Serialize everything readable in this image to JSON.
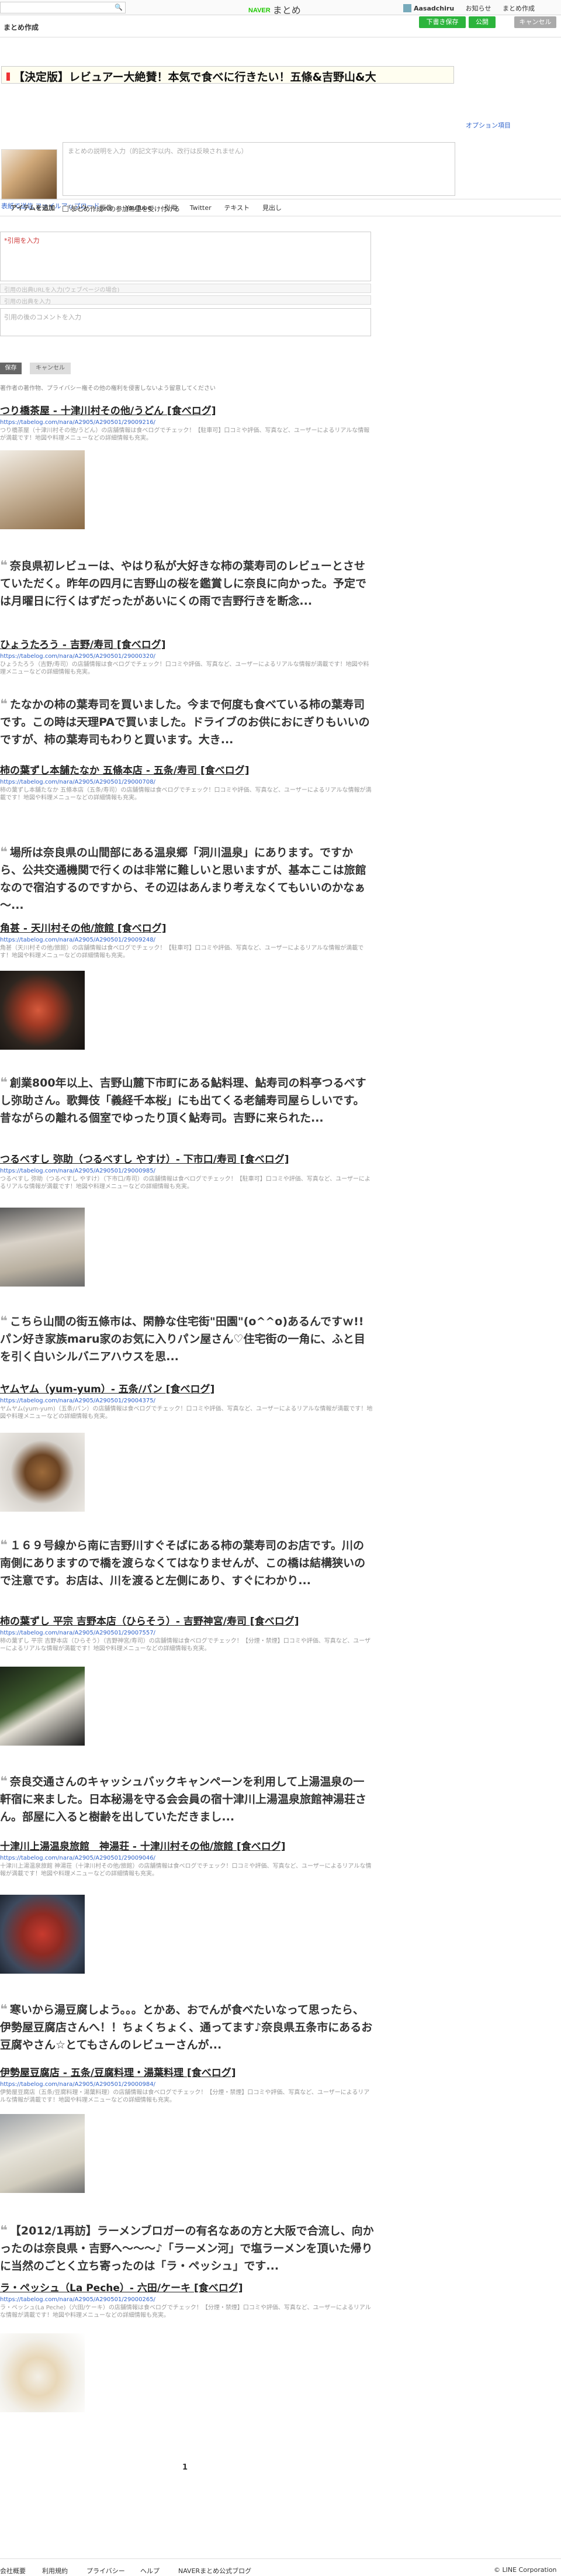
{
  "topbar": {
    "logo_naver": "NAVER",
    "logo_text": "まとめ",
    "user": "Aasadchiru",
    "nav": [
      "お知らせ",
      "まとめ作成"
    ]
  },
  "header": {
    "title": "まとめ作成",
    "btn_draft": "下書き保存",
    "btn_publish": "公開",
    "btn_cancel": "キャンセル"
  },
  "editor": {
    "title": "【決定版】レビュアー大絶賛！本気で食べに行きたい！五條&吉野山&大",
    "option_link": "オプション項目",
    "description_placeholder": "まとめの説明を入力（的記文字以内、改行は反映されません）",
    "thumbnail_link": "表紙で送信 ファイルアップロード",
    "accept_label": "まとめ作成への参加希望を受け付ける"
  },
  "tabs": [
    "アイテムを追加",
    "リンク",
    "画像",
    "YouTube",
    "引用",
    "Twitter",
    "テキスト",
    "見出し"
  ],
  "form": {
    "quote_placeholder": "*引用を入力",
    "source_url": "引用の出典URLを入力(ウェブページの場合)",
    "source_title": "引用の出典を入力",
    "comment_placeholder": "引用の後のコメントを入力",
    "save": "保存",
    "cancel": "キャンセル",
    "note": "著作者の著作物、プライバシー権その他の権利を侵害しないよう留意してください"
  },
  "items": [
    {
      "title": "つり橋茶屋 - 十津川村その他/うどん [食べログ]",
      "url": "https://tabelog.com/nara/A2905/A290501/29009216/",
      "desc": "つり橋茶屋（十津川村その他/うどん）の店舗情報は食べログでチェック！【駐車可】口コミや評価、写真など、ユーザーによるリアルな情報が満載です！地図や料理メニューなどの詳細情報も充実。"
    },
    {
      "quote": "奈良県初レビューは、やはり私が大好きな柿の葉寿司のレビューとさせていただく。昨年の四月に吉野山の桜を鑑賞しに奈良に向かった。予定では月曜日に行くはずだったがあいにくの雨で吉野行きを断念...",
      "title": "ひょうたろう - 吉野/寿司 [食べログ]",
      "url": "https://tabelog.com/nara/A2905/A290501/29000320/",
      "desc": "ひょうたろう（吉野/寿司）の店舗情報は食べログでチェック！口コミや評価、写真など、ユーザーによるリアルな情報が満載です！地図や料理メニューなどの詳細情報も充実。"
    },
    {
      "quote": "たなかの柿の葉寿司を買いました。今まで何度も食べている柿の葉寿司です。この時は天理PAで買いました。ドライブのお供におにぎりもいいのですが、柿の葉寿司もわりと買います。大き...",
      "title": "柿の葉ずし本舗たなか 五條本店 - 五条/寿司 [食べログ]",
      "url": "https://tabelog.com/nara/A2905/A290501/29000708/",
      "desc": "柿の葉ずし本舗たなか 五條本店（五条/寿司）の店舗情報は食べログでチェック！口コミや評価、写真など、ユーザーによるリアルな情報が満載です！地図や料理メニューなどの詳細情報も充実。"
    },
    {
      "quote": "場所は奈良県の山間部にある温泉郷「洞川温泉」にあります。ですから、公共交通機関で行くのは非常に難しいと思いますが、基本ここは旅館なので宿泊するのですから、その辺はあんまり考えなくてもいいのかなぁ～...",
      "title": "角甚 - 天川村その他/旅館 [食べログ]",
      "url": "https://tabelog.com/nara/A2905/A290501/29009248/",
      "desc": "角甚（天川村その他/旅館）の店舗情報は食べログでチェック！【駐車可】口コミや評価、写真など、ユーザーによるリアルな情報が満載です！地図や料理メニューなどの詳細情報も充実。"
    },
    {
      "quote": "創業800年以上、吉野山麓下市町にある鮎料理、鮎寿司の料亭つるべすし弥助さん。歌舞伎「義経千本桜」にも出てくる老舗寿司屋らしいです。昔ながらの離れる個室でゆったり頂く鮎寿司。吉野に来られた...",
      "title": "つるべすし 弥助（つるべすし やすけ）- 下市口/寿司 [食べログ]",
      "url": "https://tabelog.com/nara/A2905/A290501/29000985/",
      "desc": "つるべすし 弥助（つるべすし やすけ）（下市口/寿司）の店舗情報は食べログでチェック！【駐車可】口コミや評価、写真など、ユーザーによるリアルな情報が満載です！地図や料理メニューなどの詳細情報も充実。"
    },
    {
      "quote": "こちら山間の街五條市は、閑静な住宅街\"田園\"(o^^o)あるんですｗ!!パン好き家族maru家のお気に入りパン屋さん♡住宅街の一角に、ふと目を引く白いシルバニアハウスを思...",
      "title": "ヤムヤム（yum-yum）- 五条/パン [食べログ]",
      "url": "https://tabelog.com/nara/A2905/A290501/29004375/",
      "desc": "ヤムヤム(yum-yum)（五条/パン）の店舗情報は食べログでチェック！口コミや評価、写真など、ユーザーによるリアルな情報が満載です！地図や料理メニューなどの詳細情報も充実。"
    },
    {
      "quote": "１６９号線から南に吉野川すぐそばにある柿の葉寿司のお店です。川の南側にありますので橋を渡らなくてはなりませんが、この橋は結構狭いので注意です。お店は、川を渡ると左側にあり、すぐにわかり...",
      "title": "柿の葉ずし 平宗 吉野本店（ひらそう）- 吉野神宮/寿司 [食べログ]",
      "url": "https://tabelog.com/nara/A2905/A290501/29007557/",
      "desc": "柿の葉ずし 平宗 吉野本店（ひらそう）（吉野神宮/寿司）の店舗情報は食べログでチェック！【分煙・禁煙】口コミや評価、写真など、ユーザーによるリアルな情報が満載です！地図や料理メニューなどの詳細情報も充実。"
    },
    {
      "quote": "奈良交通さんのキャッシュバックキャンペーンを利用して上湯温泉の一軒宿に来ました。日本秘湯を守る会会員の宿十津川上湯温泉旅館神湯荘さん。部屋に入ると樹齢を出していただきまし...",
      "title": "十津川上湯温泉旅館　神湯荘 - 十津川村その他/旅館 [食べログ]",
      "url": "https://tabelog.com/nara/A2905/A290501/29009046/",
      "desc": "十津川上湯温泉旅館 神湯荘（十津川村その他/旅館）の店舗情報は食べログでチェック！口コミや評価、写真など、ユーザーによるリアルな情報が満載です！地図や料理メニューなどの詳細情報も充実。"
    },
    {
      "quote": "寒いから湯豆腐しよう。。。とかあ、おでんが食べたいなって思ったら、伊勢屋豆腐店さんへ！！ちょくちょく、通ってます♪奈良県五条市にあるお豆腐やさん☆とてもさんのレビューさんが...",
      "title": "伊勢屋豆腐店 - 五条/豆腐料理・湯葉料理 [食べログ]",
      "url": "https://tabelog.com/nara/A2905/A290501/29000984/",
      "desc": "伊勢屋豆腐店（五条/豆腐料理・湯葉料理）の店舗情報は食べログでチェック！【分煙・禁煙】口コミや評価、写真など、ユーザーによるリアルな情報が満載です！地図や料理メニューなどの詳細情報も充実。"
    },
    {
      "quote": "【2012/1再訪】ラーメンブロガーの有名なあの方と大阪で合流し、向かったのは奈良県・吉野へ～～～♪「ラーメン河」で塩ラーメンを頂いた帰りに当然のごとく立ち寄ったのは「ラ・ペッシュ」です...",
      "title": "ラ・ペッシュ（La Peche）- 六田/ケーキ [食べログ]",
      "url": "https://tabelog.com/nara/A2905/A290501/29000265/",
      "desc": "ラ・ペッシュ(La Peche)（六田/ケーキ）の店舗情報は食べログでチェック！【分煙・禁煙】口コミや評価、写真など、ユーザーによるリアルな情報が満載です！地図や料理メニューなどの詳細情報も充実。"
    }
  ],
  "pager": "1",
  "footer": {
    "links": [
      "会社概要",
      "利用規約",
      "プライバシー",
      "ヘルプ",
      "NAVERまとめ公式ブログ"
    ],
    "copyright": "© LINE Corporation"
  }
}
